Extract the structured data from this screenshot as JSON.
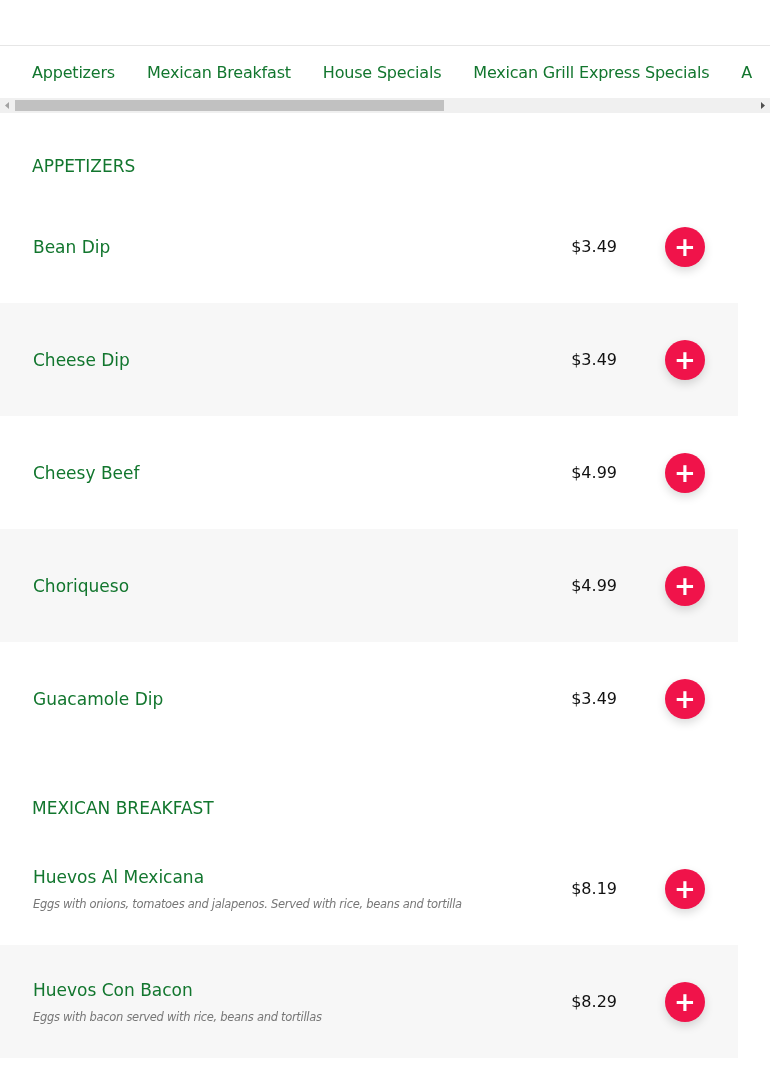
{
  "tabs": [
    {
      "label": "Appetizers"
    },
    {
      "label": "Mexican Breakfast"
    },
    {
      "label": "House Specials"
    },
    {
      "label": "Mexican Grill Express Specials"
    },
    {
      "label": "A"
    }
  ],
  "sections": [
    {
      "title": "APPETIZERS",
      "items": [
        {
          "name": "Bean Dip",
          "price": "$3.49",
          "button": "+"
        },
        {
          "name": "Cheese Dip",
          "price": "$3.49",
          "button": "+"
        },
        {
          "name": "Cheesy Beef",
          "price": "$4.99",
          "button": "+"
        },
        {
          "name": "Choriqueso",
          "price": "$4.99",
          "button": "+"
        },
        {
          "name": "Guacamole Dip",
          "price": "$3.49",
          "button": "+"
        }
      ]
    },
    {
      "title": "MEXICAN BREAKFAST",
      "items": [
        {
          "name": "Huevos Al Mexicana",
          "description": "Eggs with onions, tomatoes and jalapenos. Served with rice, beans and tortilla",
          "price": "$8.19",
          "button": "+"
        },
        {
          "name": "Huevos Con Bacon",
          "description": "Eggs with bacon served with rice, beans and tortillas",
          "price": "$8.29",
          "button": "+"
        }
      ]
    }
  ]
}
